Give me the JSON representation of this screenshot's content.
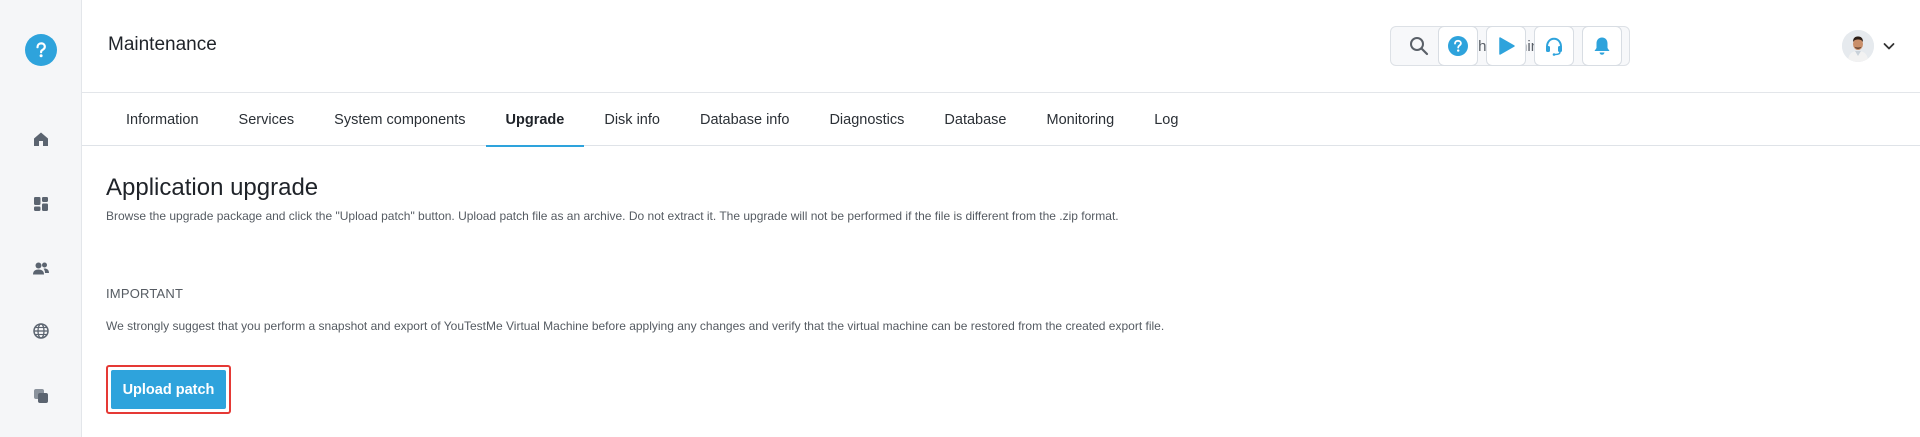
{
  "header": {
    "title": "Maintenance",
    "search_placeholder": "Search anything"
  },
  "tabs": [
    {
      "label": "Information"
    },
    {
      "label": "Services"
    },
    {
      "label": "System components"
    },
    {
      "label": "Upgrade",
      "active": true
    },
    {
      "label": "Disk info"
    },
    {
      "label": "Database info"
    },
    {
      "label": "Diagnostics"
    },
    {
      "label": "Database"
    },
    {
      "label": "Monitoring"
    },
    {
      "label": "Log"
    }
  ],
  "main": {
    "title": "Application upgrade",
    "description": "Browse the upgrade package and click the \"Upload patch\" button. Upload patch file as an archive. Do not extract it. The upgrade will not be performed if the file is different from the .zip format.",
    "important_title": "IMPORTANT",
    "important_text": "We strongly suggest that you perform a snapshot and export of YouTestMe Virtual Machine before applying any changes and verify that the virtual machine can be restored from the created export file.",
    "upload_label": "Upload patch"
  },
  "colors": {
    "accent": "#2ea3dc",
    "highlight_border": "#e53935"
  },
  "icons": {
    "rail": [
      "home-icon",
      "dashboard-icon",
      "users-icon",
      "globe-icon",
      "documents-icon"
    ],
    "header": [
      "help-icon",
      "play-icon",
      "headset-icon",
      "bell-icon"
    ]
  }
}
